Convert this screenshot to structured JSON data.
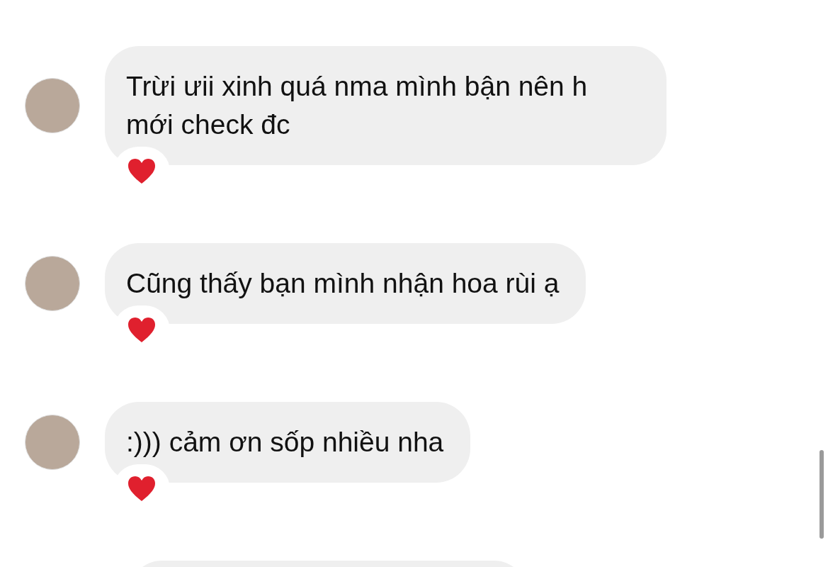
{
  "messages": [
    {
      "text": "Trừi ưii xinh quá nma mình bận nên h mới check đc",
      "reaction": true
    },
    {
      "text": "Cũng thấy bạn mình nhận hoa rùi ạ",
      "reaction": true
    },
    {
      "text": ":))) cảm ơn sốp nhiều nha",
      "reaction": true
    }
  ]
}
